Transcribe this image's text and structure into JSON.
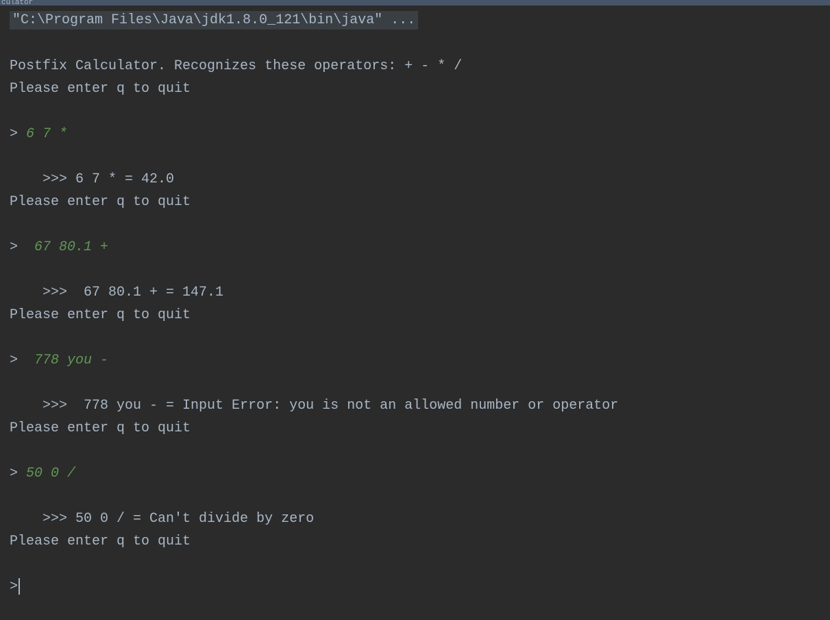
{
  "header": {
    "title": "culator"
  },
  "console": {
    "command": "\"C:\\Program Files\\Java\\jdk1.8.0_121\\bin\\java\" ...",
    "intro1": "Postfix Calculator. Recognizes these operators: + - * /",
    "quit_msg": "Please enter q to quit",
    "prompt": "> ",
    "interactions": [
      {
        "input": "6 7 *",
        "result": "    >>> 6 7 * = 42.0"
      },
      {
        "input": " 67 80.1 +",
        "result": "    >>>  67 80.1 + = 147.1"
      },
      {
        "input": " 778 you -",
        "result": "    >>>  778 you - = Input Error: you is not an allowed number or operator"
      },
      {
        "input": "50 0 /",
        "result": "    >>> 50 0 / = Can't divide by zero"
      }
    ],
    "final_prompt": ">"
  }
}
